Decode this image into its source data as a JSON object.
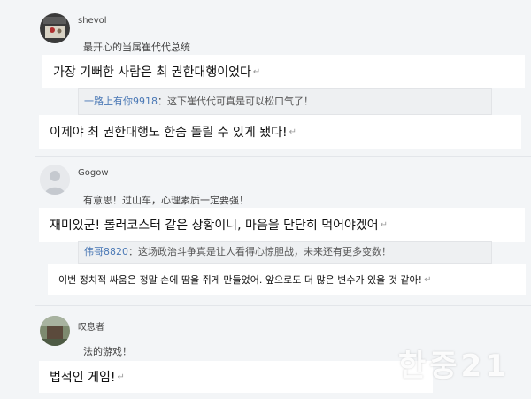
{
  "comments": [
    {
      "username": "shevol",
      "text_cn": "最开心的当属崔代代总统",
      "text_kr": "가장 기뻐한 사람은 최 권한대행이었다",
      "reply": {
        "user": "一路上有你9918",
        "sep": "：",
        "text_cn": "这下崔代代可真是可以松口气了！",
        "text_kr": "이제야 최 권한대행도 한숨 돌릴 수 있게 됐다!"
      }
    },
    {
      "username": "Gogow",
      "text_cn": "有意思！过山车，心理素质一定要强！",
      "text_kr": "재미있군! 롤러코스터 같은 상황이니, 마음을 단단히 먹어야겠어",
      "reply": {
        "user": "伟哥8820",
        "sep": "：",
        "text_cn": "这场政治斗争真是让人看得心惊胆战，未来还有更多变数！",
        "text_kr": "이번 정치적 싸움은 정말 손에 땀을 쥐게 만들었어. 앞으로도 더 많은 변수가 있을 것 같아!"
      }
    },
    {
      "username": "叹息者",
      "text_cn": "法的游戏！",
      "text_kr": "법적인 게임!"
    }
  ],
  "return_mark": "↵",
  "watermark": "한중21"
}
